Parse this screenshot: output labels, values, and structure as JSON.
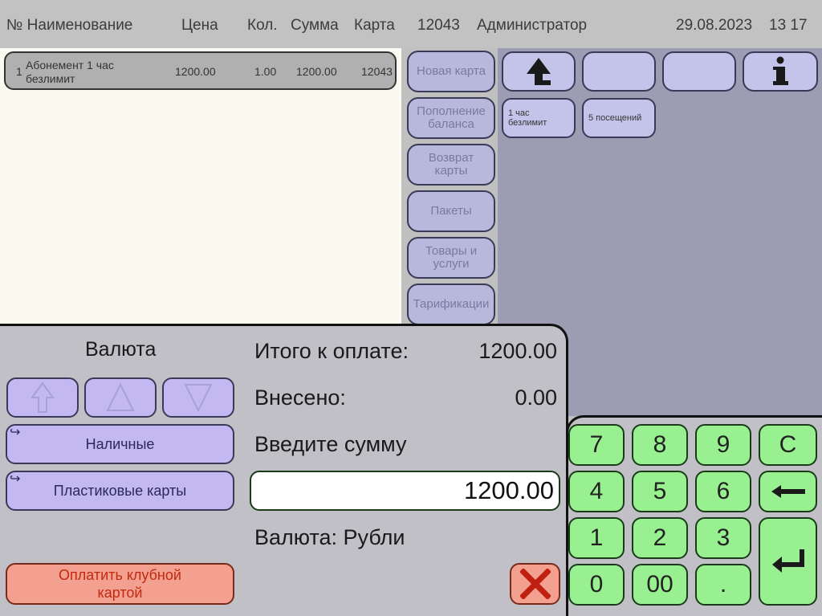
{
  "colors": {
    "receipt_bg": "#fafaf0",
    "tariff_bg": "#9c9cb2",
    "function_button_bg": "#b8b8dc",
    "currency_button_bg": "#c4b8f2",
    "numpad_key_bg": "#98f090",
    "danger_button_bg": "#f4a090"
  },
  "header": {
    "col_no_name": "№ Наименование",
    "col_price": "Цена",
    "col_qty": "Кол.",
    "col_sum": "Сумма",
    "col_card": "Карта",
    "card_number": "12043",
    "operator": "Администратор",
    "date": "29.08.2023",
    "time": "13 17"
  },
  "receipt": {
    "items": [
      {
        "no": "1",
        "name_line1": "Абонемент 1 час",
        "name_line2": "безлимит",
        "price": "1200.00",
        "qty": "1.00",
        "sum": "1200.00",
        "card": "12043"
      }
    ]
  },
  "functions": {
    "new_card": "Новая карта",
    "top_up_line1": "Пополнение",
    "top_up_line2": "баланса",
    "return_card_line1": "Возврат",
    "return_card_line2": "карты",
    "packages": "Пакеты",
    "goods_line1": "Товары и",
    "goods_line2": "услуги",
    "tariffication": "Тарификации"
  },
  "tariff_panel": {
    "up_icon": "arrow-up-icon",
    "info_icon": "info-icon",
    "items": [
      {
        "line1": "1 час",
        "line2": "безлимит"
      },
      {
        "line1": "5 посещений",
        "line2": ""
      }
    ]
  },
  "payment": {
    "currency_title": "Валюта",
    "total_label": "Итого к оплате:",
    "total_value": "1200.00",
    "paid_label": "Внесено:",
    "paid_value": "0.00",
    "enter_amount_label": "Введите сумму",
    "amount_input_value": "1200.00",
    "currency_status": "Валюта: Рубли",
    "methods": [
      {
        "label": "Наличные"
      },
      {
        "label": "Пластиковые карты"
      }
    ],
    "club_card_line1": "Оплатить клубной",
    "club_card_line2": "картой"
  },
  "numpad": {
    "keys": [
      "7",
      "8",
      "9",
      "C",
      "4",
      "5",
      "6",
      "1",
      "2",
      "3",
      "0",
      "00",
      "."
    ],
    "backspace_icon": "backspace-arrow-icon",
    "enter_icon": "enter-icon"
  }
}
